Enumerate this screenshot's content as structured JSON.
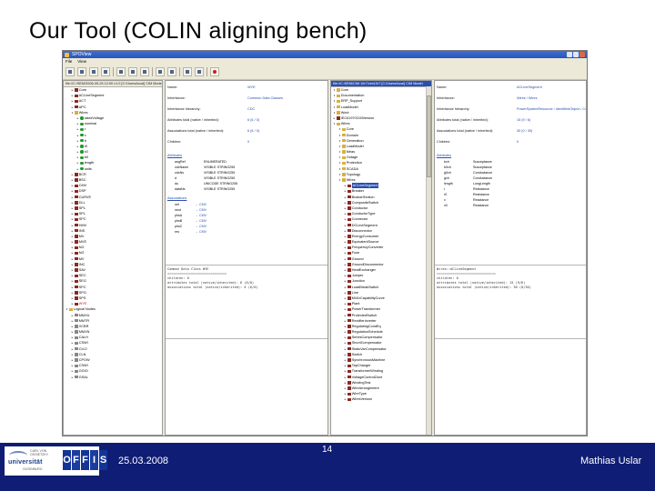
{
  "slide": {
    "title": "Our Tool (COLIN aligning bench)",
    "date": "25.03.2008",
    "page_number": "14",
    "author": "Mathias Uslar"
  },
  "logos": {
    "university_small": "CARL VON OSSIETZKY",
    "university": "universität",
    "university_sub": "OLDENBURG",
    "offis_letters": [
      "O",
      "F",
      "F",
      "I",
      "S"
    ]
  },
  "window": {
    "title": "SPOView",
    "menu": [
      "File",
      "View"
    ]
  },
  "left_tree": {
    "header": "file://C:/SEM/2006-05-25 12:00 v1.0  [C:/Users/local]  CIM Model",
    "items": [
      {
        "label": "Core",
        "indent": 1,
        "icon": "class"
      },
      {
        "label": "ACLineSegment",
        "indent": 1,
        "icon": "class"
      },
      {
        "label": "ACT",
        "indent": 1,
        "icon": "class"
      },
      {
        "label": "APC",
        "indent": 1,
        "icon": "class"
      },
      {
        "label": "Wires",
        "indent": 1,
        "icon": "pkg"
      },
      {
        "label": "ratedVoltage",
        "indent": 2,
        "icon": "attr"
      },
      {
        "label": "nominal",
        "indent": 2,
        "icon": "attr"
      },
      {
        "label": "r",
        "indent": 2,
        "icon": "attr"
      },
      {
        "label": "x",
        "indent": 2,
        "icon": "attr"
      },
      {
        "label": "b",
        "indent": 2,
        "icon": "attr"
      },
      {
        "label": "r0",
        "indent": 2,
        "icon": "attr"
      },
      {
        "label": "x0",
        "indent": 2,
        "icon": "attr"
      },
      {
        "label": "b0",
        "indent": 2,
        "icon": "attr"
      },
      {
        "label": "length",
        "indent": 2,
        "icon": "attr"
      },
      {
        "label": "units",
        "indent": 2,
        "icon": "attr"
      },
      {
        "label": "BCR",
        "indent": 1,
        "icon": "class"
      },
      {
        "label": "BSC",
        "indent": 1,
        "icon": "class"
      },
      {
        "label": "CMV",
        "indent": 1,
        "icon": "class"
      },
      {
        "label": "DSP",
        "indent": 1,
        "icon": "class"
      },
      {
        "label": "CURVE",
        "indent": 1,
        "icon": "class"
      },
      {
        "label": "DLL",
        "indent": 1,
        "icon": "class"
      },
      {
        "label": "SPL",
        "indent": 1,
        "icon": "class"
      },
      {
        "label": "SPL",
        "indent": 1,
        "icon": "class"
      },
      {
        "label": "SPC",
        "indent": 1,
        "icon": "class"
      },
      {
        "label": "HMV",
        "indent": 1,
        "icon": "class"
      },
      {
        "label": "INS",
        "indent": 1,
        "icon": "class"
      },
      {
        "label": "MV",
        "indent": 1,
        "icon": "class"
      },
      {
        "label": "MVE",
        "indent": 1,
        "icon": "class"
      },
      {
        "label": "NG",
        "indent": 1,
        "icon": "class"
      },
      {
        "label": "NG",
        "indent": 1,
        "icon": "class"
      },
      {
        "label": "MV",
        "indent": 1,
        "icon": "class"
      },
      {
        "label": "INC",
        "indent": 1,
        "icon": "class"
      },
      {
        "label": "SAV",
        "indent": 1,
        "icon": "class"
      },
      {
        "label": "SEC",
        "indent": 1,
        "icon": "class"
      },
      {
        "label": "SEG",
        "indent": 1,
        "icon": "class"
      },
      {
        "label": "SPC",
        "indent": 1,
        "icon": "class"
      },
      {
        "label": "SPG",
        "indent": 1,
        "icon": "class"
      },
      {
        "label": "SPS",
        "indent": 1,
        "icon": "class"
      },
      {
        "label": "WYE",
        "indent": 1,
        "icon": "class",
        "red": true
      },
      {
        "label": "Logical Nodes",
        "indent": 0,
        "icon": "pkg"
      },
      {
        "label": "MMXU",
        "indent": 1,
        "icon": "gray"
      },
      {
        "label": "MMTR",
        "indent": 1,
        "icon": "gray"
      },
      {
        "label": "XCBR",
        "indent": 1,
        "icon": "gray"
      },
      {
        "label": "MMXN",
        "indent": 1,
        "icon": "gray"
      },
      {
        "label": "CALH",
        "indent": 1,
        "icon": "gray"
      },
      {
        "label": "CSWI",
        "indent": 1,
        "icon": "gray"
      },
      {
        "label": "CILO",
        "indent": 1,
        "icon": "gray"
      },
      {
        "label": "CLN",
        "indent": 1,
        "icon": "gray"
      },
      {
        "label": "CPOW",
        "indent": 1,
        "icon": "gray"
      },
      {
        "label": "CSWI",
        "indent": 1,
        "icon": "gray"
      },
      {
        "label": "GGIO",
        "indent": 1,
        "icon": "gray"
      },
      {
        "label": "GSAL",
        "indent": 1,
        "icon": "gray"
      }
    ]
  },
  "left_detail": {
    "rows": [
      {
        "key": "Name:",
        "value": "WYE"
      },
      {
        "key": "Inheritance:",
        "value": "Common Data Classes"
      },
      {
        "key": "Inheritance hierarchy:",
        "value": "CDC"
      },
      {
        "key": "Attributes total (native / inherited):",
        "value": "6 (6 / 0)"
      },
      {
        "key": "Associations total (native / inherited):",
        "value": "6 (6 / 0)"
      },
      {
        "key": "Children:",
        "value": "0"
      }
    ],
    "attributes_title": "Attributes",
    "attributes": [
      {
        "name": "angRef",
        "type": "ENUMERATED"
      },
      {
        "name": "cdcName",
        "type": "VISIBLE STRING255"
      },
      {
        "name": "cdcNs",
        "type": "VISIBLE STRING255"
      },
      {
        "name": "d",
        "type": "VISIBLE STRING255"
      },
      {
        "name": "du",
        "type": "UNICODE STRING255"
      },
      {
        "name": "dataNs",
        "type": "VISIBLE STRING255"
      }
    ],
    "associations_title": "Associations",
    "associations": [
      {
        "name": "net",
        "target": "CMV"
      },
      {
        "name": "neut",
        "target": "CMV"
      },
      {
        "name": "phsA",
        "target": "CMV"
      },
      {
        "name": "phsB",
        "target": "CMV"
      },
      {
        "name": "phsC",
        "target": "CMV"
      },
      {
        "name": "res",
        "target": "CMV"
      }
    ],
    "description": "Common Data Class WYE\n==============================\nchildren: 0\nattributes total (native/inherited): 6 (6/0)\nassociations total (native/inherited): 6 (6/0)"
  },
  "right_tree": {
    "header": "file://C:/SEM/CIM 10r7/cim10r7 [C:/Users/local]  CIM Model",
    "items": [
      {
        "label": "Core",
        "indent": 0,
        "icon": "pkg"
      },
      {
        "label": "Documentation",
        "indent": 0,
        "icon": "pkg"
      },
      {
        "label": "ERP_Support",
        "indent": 0,
        "icon": "pkg"
      },
      {
        "label": "LoadModel",
        "indent": 0,
        "icon": "pkg"
      },
      {
        "label": "Work",
        "indent": 0,
        "icon": "pkg"
      },
      {
        "label": "IEC61970CIMVersion",
        "indent": 0,
        "icon": "class"
      },
      {
        "label": "Wires",
        "indent": 0,
        "icon": "pkg"
      },
      {
        "label": "Core",
        "indent": 1,
        "icon": "pkg"
      },
      {
        "label": "Domain",
        "indent": 1,
        "icon": "pkg"
      },
      {
        "label": "Generation",
        "indent": 1,
        "icon": "pkg"
      },
      {
        "label": "LoadModel",
        "indent": 1,
        "icon": "pkg"
      },
      {
        "label": "Meas",
        "indent": 1,
        "icon": "pkg"
      },
      {
        "label": "Outage",
        "indent": 1,
        "icon": "pkg"
      },
      {
        "label": "Protection",
        "indent": 1,
        "icon": "pkg"
      },
      {
        "label": "SCADA",
        "indent": 1,
        "icon": "pkg"
      },
      {
        "label": "Topology",
        "indent": 1,
        "icon": "pkg"
      },
      {
        "label": "Wires",
        "indent": 1,
        "icon": "pkg"
      },
      {
        "label": "ACLineSegment",
        "indent": 2,
        "icon": "class",
        "red": true,
        "selected": true
      },
      {
        "label": "Breaker",
        "indent": 2,
        "icon": "class"
      },
      {
        "label": "BusbarSection",
        "indent": 2,
        "icon": "class"
      },
      {
        "label": "CompositeSwitch",
        "indent": 2,
        "icon": "class"
      },
      {
        "label": "Conductor",
        "indent": 2,
        "icon": "class"
      },
      {
        "label": "ConductorType",
        "indent": 2,
        "icon": "class"
      },
      {
        "label": "Connector",
        "indent": 2,
        "icon": "class"
      },
      {
        "label": "DCLineSegment",
        "indent": 2,
        "icon": "class"
      },
      {
        "label": "Disconnector",
        "indent": 2,
        "icon": "class"
      },
      {
        "label": "EnergyConsumer",
        "indent": 2,
        "icon": "class"
      },
      {
        "label": "EquivalentSource",
        "indent": 2,
        "icon": "class"
      },
      {
        "label": "FrequencyConverter",
        "indent": 2,
        "icon": "class"
      },
      {
        "label": "Fuse",
        "indent": 2,
        "icon": "class"
      },
      {
        "label": "Ground",
        "indent": 2,
        "icon": "class"
      },
      {
        "label": "GroundDisconnector",
        "indent": 2,
        "icon": "class"
      },
      {
        "label": "HeatExchanger",
        "indent": 2,
        "icon": "class"
      },
      {
        "label": "Jumper",
        "indent": 2,
        "icon": "class"
      },
      {
        "label": "Junction",
        "indent": 2,
        "icon": "class"
      },
      {
        "label": "LoadBreakSwitch",
        "indent": 2,
        "icon": "class"
      },
      {
        "label": "Line",
        "indent": 2,
        "icon": "class"
      },
      {
        "label": "MVArCapabilityCurve",
        "indent": 2,
        "icon": "class"
      },
      {
        "label": "Plant",
        "indent": 2,
        "icon": "class"
      },
      {
        "label": "PowerTransformer",
        "indent": 2,
        "icon": "class"
      },
      {
        "label": "ProtectedSwitch",
        "indent": 2,
        "icon": "class"
      },
      {
        "label": "RectifierInverter",
        "indent": 2,
        "icon": "class"
      },
      {
        "label": "RegulatingCondEq",
        "indent": 2,
        "icon": "class"
      },
      {
        "label": "RegulationSchedule",
        "indent": 2,
        "icon": "class"
      },
      {
        "label": "SeriesCompensator",
        "indent": 2,
        "icon": "class"
      },
      {
        "label": "ShuntCompensator",
        "indent": 2,
        "icon": "class"
      },
      {
        "label": "StaticVarCompensator",
        "indent": 2,
        "icon": "class"
      },
      {
        "label": "Switch",
        "indent": 2,
        "icon": "class"
      },
      {
        "label": "SynchronousMachine",
        "indent": 2,
        "icon": "class"
      },
      {
        "label": "TapChanger",
        "indent": 2,
        "icon": "class"
      },
      {
        "label": "TransformerWinding",
        "indent": 2,
        "icon": "class"
      },
      {
        "label": "VoltageControlZone",
        "indent": 2,
        "icon": "class"
      },
      {
        "label": "WindingTest",
        "indent": 2,
        "icon": "class"
      },
      {
        "label": "WireArrangement",
        "indent": 2,
        "icon": "class"
      },
      {
        "label": "WireType",
        "indent": 2,
        "icon": "class"
      },
      {
        "label": "WiresVersion",
        "indent": 2,
        "icon": "class"
      }
    ]
  },
  "right_detail": {
    "rows": [
      {
        "key": "Name:",
        "value": "ACLineSegment"
      },
      {
        "key": "Inheritance:",
        "value": "Wires / Wires"
      },
      {
        "key": "Inheritance hierarchy:",
        "value": "PowerSystemResource / IdentifiedObject / Conductor"
      },
      {
        "key": "Attributes total (native / inherited):",
        "value": "15 (9 / 6)"
      },
      {
        "key": "Associations total (native / inherited):",
        "value": "30 (0 / 30)"
      },
      {
        "key": "Children:",
        "value": "0"
      }
    ],
    "attributes_title": "Attributes",
    "attributes": [
      {
        "name": "bch",
        "type": "Susceptance"
      },
      {
        "name": "b0ch",
        "type": "Susceptance"
      },
      {
        "name": "g0ch",
        "type": "Conductance"
      },
      {
        "name": "gch",
        "type": "Conductance"
      },
      {
        "name": "length",
        "type": "LongLength"
      },
      {
        "name": "r",
        "type": "Resistance"
      },
      {
        "name": "r0",
        "type": "Resistance"
      },
      {
        "name": "x",
        "type": "Reactance"
      },
      {
        "name": "x0",
        "type": "Reactance"
      }
    ],
    "description": "Wires::ACLineSegment\n==============================\nchildren: 0\nattributes total (native/inherited): 15 (9/6)\nassociations total (native/inherited): 30 (0/30)"
  }
}
